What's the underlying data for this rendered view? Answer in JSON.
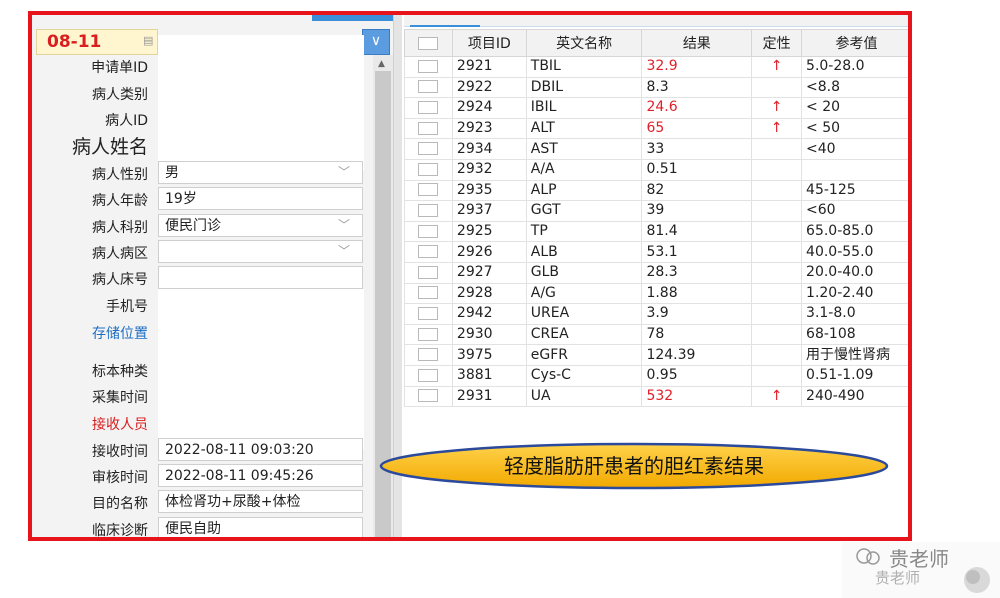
{
  "header": {
    "date": "08-11",
    "date_icon": "calendar-icon"
  },
  "patient_fields": [
    {
      "label": "申请单ID",
      "value": ""
    },
    {
      "label": "病人类别",
      "value": ""
    },
    {
      "label": "病人ID",
      "value": ""
    },
    {
      "label": "病人姓名",
      "value": ""
    },
    {
      "label": "病人性别",
      "value": "男"
    },
    {
      "label": "病人年龄",
      "value": "19岁"
    },
    {
      "label": "病人科别",
      "value": "便民门诊"
    },
    {
      "label": "病人病区",
      "value": ""
    },
    {
      "label": "病人床号",
      "value": ""
    },
    {
      "label": "手机号",
      "value": ""
    },
    {
      "label": "存储位置",
      "value": ""
    },
    {
      "label": "标本种类",
      "value": ""
    },
    {
      "label": "采集时间",
      "value": ""
    },
    {
      "label": "接收人员",
      "value": ""
    },
    {
      "label": "接收时间",
      "value": "2022-08-11 09:03:20"
    },
    {
      "label": "审核时间",
      "value": "2022-08-11 09:45:26"
    },
    {
      "label": "目的名称",
      "value": "体检肾功+尿酸+体检"
    },
    {
      "label": "临床诊断",
      "value": "便民自助"
    }
  ],
  "table": {
    "columns": [
      "",
      "项目ID",
      "英文名称",
      "结果",
      "定性",
      "参考值"
    ],
    "rows": [
      {
        "id": "2921",
        "name": "TBIL",
        "result": "32.9",
        "flag": "↑",
        "ref": "5.0-28.0",
        "high": true
      },
      {
        "id": "2922",
        "name": "DBIL",
        "result": "8.3",
        "flag": "",
        "ref": "<8.8",
        "high": false
      },
      {
        "id": "2924",
        "name": "IBIL",
        "result": "24.6",
        "flag": "↑",
        "ref": "< 20",
        "high": true
      },
      {
        "id": "2923",
        "name": "ALT",
        "result": "65",
        "flag": "↑",
        "ref": "< 50",
        "high": true
      },
      {
        "id": "2934",
        "name": "AST",
        "result": "33",
        "flag": "",
        "ref": "<40",
        "high": false
      },
      {
        "id": "2932",
        "name": "A/A",
        "result": "0.51",
        "flag": "",
        "ref": "",
        "high": false
      },
      {
        "id": "2935",
        "name": "ALP",
        "result": "82",
        "flag": "",
        "ref": "45-125",
        "high": false
      },
      {
        "id": "2937",
        "name": "GGT",
        "result": "39",
        "flag": "",
        "ref": "<60",
        "high": false
      },
      {
        "id": "2925",
        "name": "TP",
        "result": "81.4",
        "flag": "",
        "ref": "65.0-85.0",
        "high": false
      },
      {
        "id": "2926",
        "name": "ALB",
        "result": "53.1",
        "flag": "",
        "ref": "40.0-55.0",
        "high": false
      },
      {
        "id": "2927",
        "name": "GLB",
        "result": "28.3",
        "flag": "",
        "ref": "20.0-40.0",
        "high": false
      },
      {
        "id": "2928",
        "name": "A/G",
        "result": "1.88",
        "flag": "",
        "ref": "1.20-2.40",
        "high": false
      },
      {
        "id": "2942",
        "name": "UREA",
        "result": "3.9",
        "flag": "",
        "ref": "3.1-8.0",
        "high": false
      },
      {
        "id": "2930",
        "name": "CREA",
        "result": "78",
        "flag": "",
        "ref": "68-108",
        "high": false
      },
      {
        "id": "3975",
        "name": "eGFR",
        "result": "124.39",
        "flag": "",
        "ref": "用于慢性肾病",
        "high": false
      },
      {
        "id": "3881",
        "name": "Cys-C",
        "result": "0.95",
        "flag": "",
        "ref": "0.51-1.09",
        "high": false
      },
      {
        "id": "2931",
        "name": "UA",
        "result": "532",
        "flag": "↑",
        "ref": "240-490",
        "high": true
      }
    ]
  },
  "callout": {
    "text": "轻度脂肪肝患者的胆红素结果",
    "fill": "#f7b500",
    "stroke": "#2b4a9b"
  },
  "watermark": {
    "name": "贵老师",
    "script": "贵老师",
    "icon": "wechat-icon"
  },
  "colors": {
    "frame": "#e8141c",
    "high": "#e0202a",
    "accent": "#3b8fd9"
  }
}
